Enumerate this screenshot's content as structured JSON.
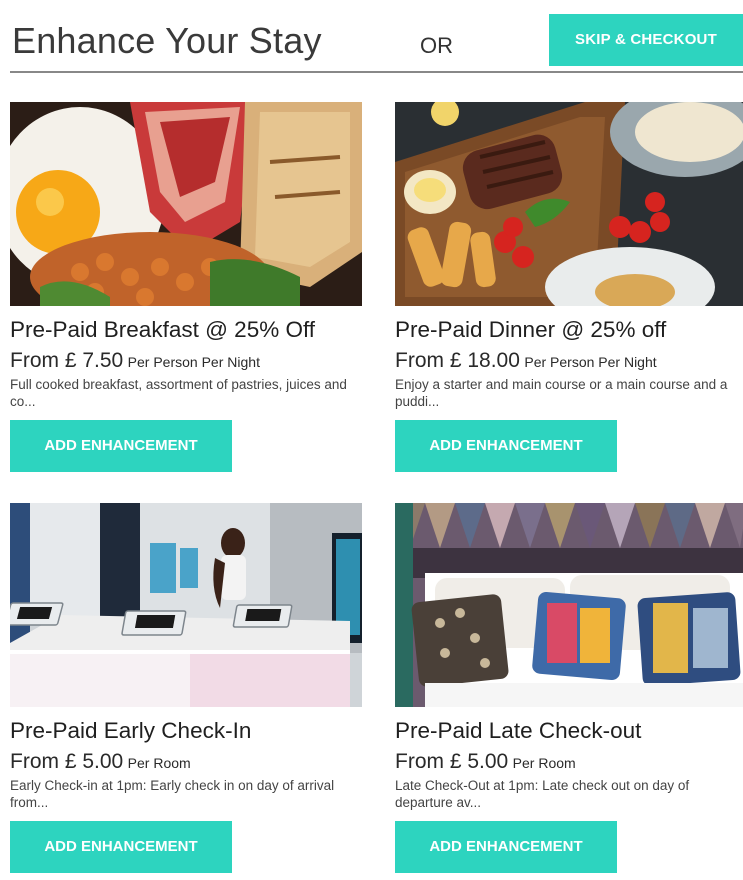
{
  "theme": {
    "accent": "#2dd4bf"
  },
  "header": {
    "title": "Enhance Your Stay",
    "or_label": "OR",
    "skip_label": "SKIP & CHECKOUT"
  },
  "cards": [
    {
      "title": "Pre-Paid Breakfast @ 25% Off",
      "price_from": "From £ 7.50",
      "price_unit": "Per Person Per Night",
      "description": "Full cooked breakfast, assortment of pastries, juices and co...",
      "button_label": "ADD ENHANCEMENT",
      "image": "breakfast-photo"
    },
    {
      "title": "Pre-Paid Dinner @ 25% off",
      "price_from": "From £ 18.00",
      "price_unit": "Per Person Per Night",
      "description": "Enjoy a starter and main course or a main course and a puddi...",
      "button_label": "ADD ENHANCEMENT",
      "image": "dinner-photo"
    },
    {
      "title": "Pre-Paid Early Check-In",
      "price_from": "From £ 5.00",
      "price_unit": "Per Room",
      "description": "Early Check-in at 1pm: Early check in on day of arrival from...",
      "button_label": "ADD ENHANCEMENT",
      "image": "check-in-lobby-photo"
    },
    {
      "title": "Pre-Paid Late Check-out",
      "price_from": "From £ 5.00",
      "price_unit": "Per Room",
      "description": "Late Check-Out at 1pm: Late check out on day of departure av...",
      "button_label": "ADD ENHANCEMENT",
      "image": "hotel-bed-photo"
    }
  ]
}
